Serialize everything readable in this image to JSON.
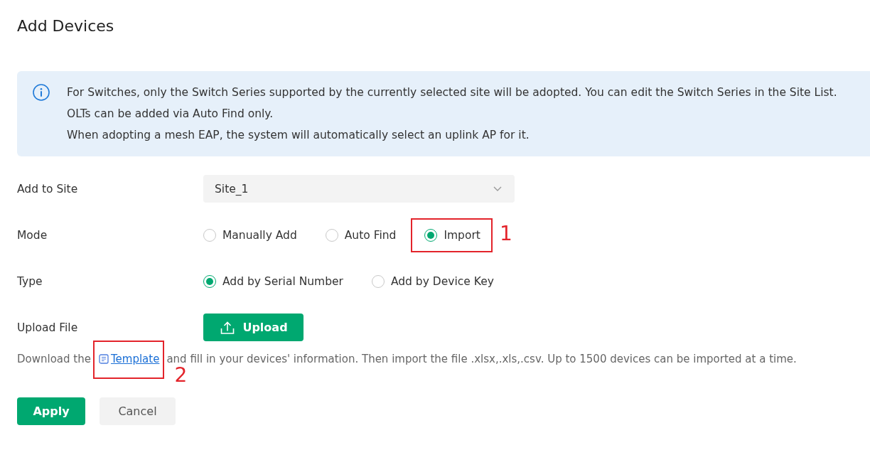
{
  "page": {
    "title": "Add Devices"
  },
  "notice": {
    "lines": [
      "For Switches, only the Switch Series supported by the currently selected site will be adopted. You can edit the Switch Series in the Site List.",
      "OLTs can be added via Auto Find only.",
      "When adopting a mesh EAP, the system will automatically select an uplink AP for it."
    ]
  },
  "form": {
    "fields": [
      {
        "kind": "select",
        "label": "Add to Site",
        "value": "Site_1"
      },
      {
        "kind": "radio",
        "label": "Mode",
        "options": [
          {
            "label": "Manually Add",
            "selected": false
          },
          {
            "label": "Auto Find",
            "selected": false
          },
          {
            "label": "Import",
            "selected": true,
            "annotation": "1"
          }
        ]
      },
      {
        "kind": "radio",
        "label": "Type",
        "options": [
          {
            "label": "Add by Serial Number",
            "selected": true
          },
          {
            "label": "Add by Device Key",
            "selected": false
          }
        ]
      },
      {
        "kind": "upload",
        "label": "Upload File",
        "button": "Upload"
      }
    ]
  },
  "hint": {
    "before": "Download the",
    "link": "Template",
    "link_annotation": "2",
    "after": "and fill in your devices' information. Then import the file .xlsx,.xls,.csv. Up to 1500 devices can be imported at a time."
  },
  "actions": [
    {
      "kind": "primary",
      "label": "Apply"
    },
    {
      "kind": "secondary",
      "label": "Cancel"
    }
  ]
}
